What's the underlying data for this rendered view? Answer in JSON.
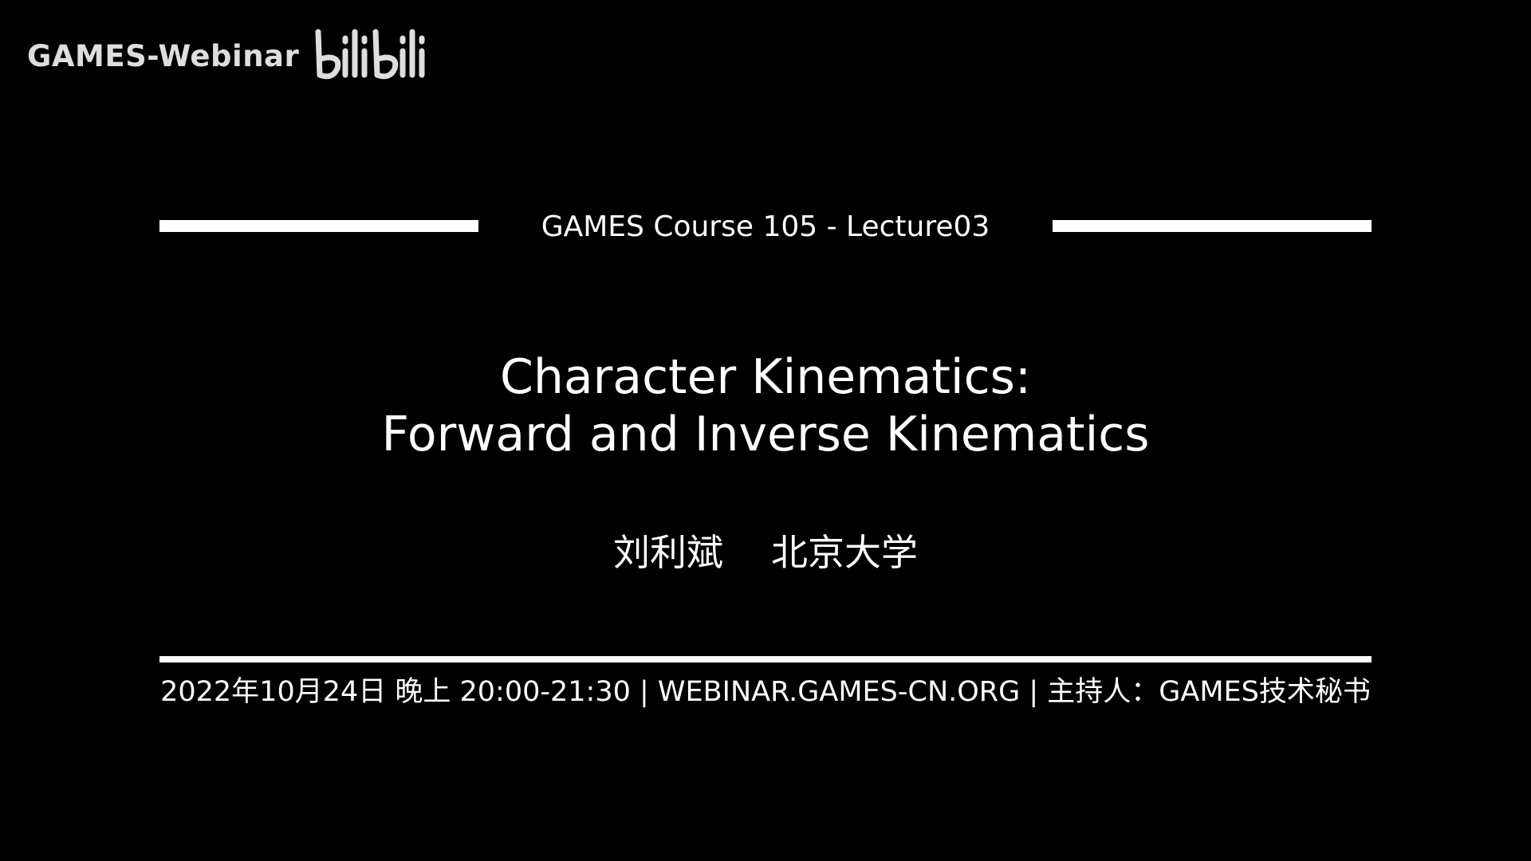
{
  "watermark": {
    "channel": "GAMES-Webinar",
    "logo_icon": "bilibili-logo-icon",
    "logo_text": "bilibili"
  },
  "course_title": "GAMES Course 105 - Lecture03",
  "main_title": {
    "line1": "Character Kinematics:",
    "line2": "Forward and Inverse Kinematics"
  },
  "presenter": {
    "name": "刘利斌",
    "affiliation": "北京大学"
  },
  "footer": {
    "info": "2022年10月24日 晚上 20:00-21:30 | WEBINAR.GAMES-CN.ORG | 主持人：GAMES技术秘书"
  },
  "colors": {
    "background": "#000000",
    "text": "#ffffff",
    "watermark": "#dedede"
  }
}
